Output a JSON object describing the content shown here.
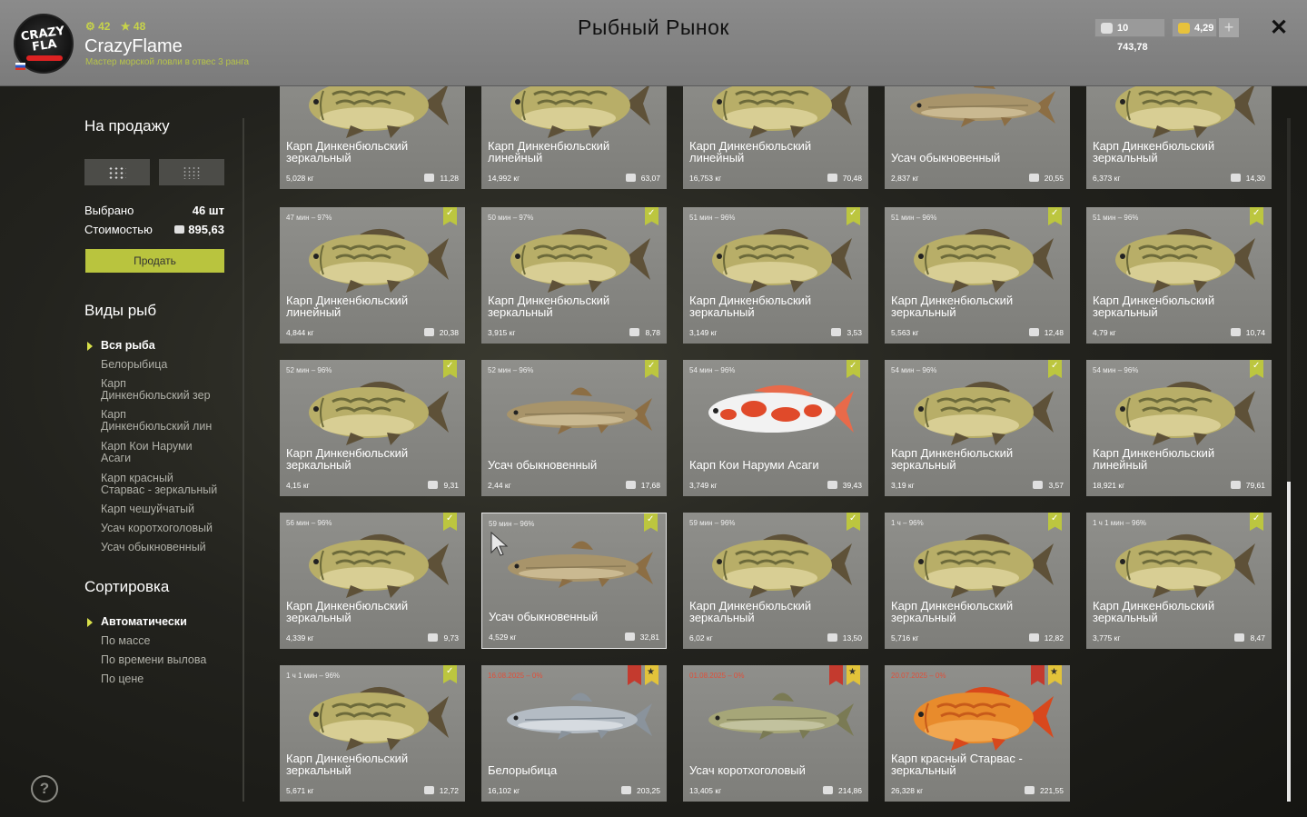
{
  "header": {
    "title": "Рыбный Рынок",
    "player": {
      "name": "CrazyFlame",
      "level": "42",
      "rank_level": "48",
      "rank": "Мастер морской ловли в отвес 3 ранга",
      "avatar_text": "CRAZY FLA"
    },
    "silver": "10 743,78",
    "gold": "4,29",
    "add_label": "+",
    "close_label": "✕"
  },
  "sidebar": {
    "sale_title": "На продажу",
    "selected_label": "Выбрано",
    "selected_value": "46 шт",
    "cost_label": "Стоимостью",
    "cost_value": "895,63",
    "sell_label": "Продать",
    "species_title": "Виды рыб",
    "species": [
      "Вся рыба",
      "Белорыбица",
      "Карп\nДинкенбюльский зер",
      "Карп\nДинкенбюльский лин",
      "Карп Кои Наруми\nАсаги",
      "Карп красный\nСтарвас - зеркальный",
      "Карп чешуйчатый",
      "Усач коротхоголовый",
      "Усач обыкновенный"
    ],
    "sort_title": "Сортировка",
    "sort_options": [
      "Автоматически",
      "По массе",
      "По времени вылова",
      "По цене"
    ],
    "help": "?"
  },
  "fish_types": {
    "carp": {
      "body": "#b8ae68",
      "scale": "#6c6a3a",
      "fin": "#5e5138",
      "belly": "#e6dca6"
    },
    "barbel": {
      "body": "#a8946a",
      "scale": "#8a7a56",
      "fin": "#8c6e44",
      "belly": "#d8c9a2"
    },
    "koi": {
      "body": "#f2f2f2",
      "scale": "#e04a2a",
      "fin": "#e86a4a",
      "belly": "#ffffff"
    },
    "whitefish": {
      "body": "#b4bcc4",
      "scale": "#7e8892",
      "fin": "#8a939c",
      "belly": "#e4e8ec"
    },
    "barbel_short": {
      "body": "#a6a678",
      "scale": "#7e7e58",
      "fin": "#7a7a54",
      "belly": "#cfcfae"
    },
    "red_carp": {
      "body": "#e88b2c",
      "scale": "#c75a1a",
      "fin": "#d8481c",
      "belly": "#f5b460"
    }
  },
  "cards": [
    {
      "meta": "",
      "name": "Карп Динкенбюльский\nзеркальный",
      "weight": "5,028 кг",
      "price": "11,28",
      "fish": "carp",
      "badge": "none"
    },
    {
      "meta": "",
      "name": "Карп Динкенбюльский\nлинейный",
      "weight": "14,992 кг",
      "price": "63,07",
      "fish": "carp",
      "badge": "none"
    },
    {
      "meta": "",
      "name": "Карп Динкенбюльский\nлинейный",
      "weight": "16,753 кг",
      "price": "70,48",
      "fish": "carp",
      "badge": "none"
    },
    {
      "meta": "",
      "name": "Усач обыкновенный",
      "weight": "2,837 кг",
      "price": "20,55",
      "fish": "barbel",
      "badge": "none"
    },
    {
      "meta": "",
      "name": "Карп Динкенбюльский\nзеркальный",
      "weight": "6,373 кг",
      "price": "14,30",
      "fish": "carp",
      "badge": "none"
    },
    {
      "meta": "47 мин – 97%",
      "name": "Карп Динкенбюльский\nлинейный",
      "weight": "4,844 кг",
      "price": "20,38",
      "fish": "carp",
      "badge": "check"
    },
    {
      "meta": "50 мин – 97%",
      "name": "Карп Динкенбюльский\nзеркальный",
      "weight": "3,915 кг",
      "price": "8,78",
      "fish": "carp",
      "badge": "check"
    },
    {
      "meta": "51 мин – 96%",
      "name": "Карп Динкенбюльский\nзеркальный",
      "weight": "3,149 кг",
      "price": "3,53",
      "fish": "carp",
      "badge": "check"
    },
    {
      "meta": "51 мин – 96%",
      "name": "Карп Динкенбюльский\nзеркальный",
      "weight": "5,563 кг",
      "price": "12,48",
      "fish": "carp",
      "badge": "check"
    },
    {
      "meta": "51 мин – 96%",
      "name": "Карп Динкенбюльский\nзеркальный",
      "weight": "4,79 кг",
      "price": "10,74",
      "fish": "carp",
      "badge": "check"
    },
    {
      "meta": "52 мин – 96%",
      "name": "Карп Динкенбюльский\nзеркальный",
      "weight": "4,15 кг",
      "price": "9,31",
      "fish": "carp",
      "badge": "check"
    },
    {
      "meta": "52 мин – 96%",
      "name": "Усач обыкновенный",
      "weight": "2,44 кг",
      "price": "17,68",
      "fish": "barbel",
      "badge": "check"
    },
    {
      "meta": "54 мин – 96%",
      "name": "Карп Кои Наруми Асаги",
      "weight": "3,749 кг",
      "price": "39,43",
      "fish": "koi",
      "badge": "check"
    },
    {
      "meta": "54 мин – 96%",
      "name": "Карп Динкенбюльский\nзеркальный",
      "weight": "3,19 кг",
      "price": "3,57",
      "fish": "carp",
      "badge": "check"
    },
    {
      "meta": "54 мин – 96%",
      "name": "Карп Динкенбюльский\nлинейный",
      "weight": "18,921 кг",
      "price": "79,61",
      "fish": "carp",
      "badge": "check"
    },
    {
      "meta": "56 мин – 96%",
      "name": "Карп Динкенбюльский\nзеркальный",
      "weight": "4,339 кг",
      "price": "9,73",
      "fish": "carp",
      "badge": "check"
    },
    {
      "meta": "59 мин – 96%",
      "name": "Усач обыкновенный",
      "weight": "4,529 кг",
      "price": "32,81",
      "fish": "barbel",
      "badge": "check",
      "selected": true
    },
    {
      "meta": "59 мин – 96%",
      "name": "Карп Динкенбюльский\nзеркальный",
      "weight": "6,02 кг",
      "price": "13,50",
      "fish": "carp",
      "badge": "check"
    },
    {
      "meta": "1 ч – 96%",
      "name": "Карп Динкенбюльский\nзеркальный",
      "weight": "5,716 кг",
      "price": "12,82",
      "fish": "carp",
      "badge": "check"
    },
    {
      "meta": "1 ч 1 мин – 96%",
      "name": "Карп Динкенбюльский\nзеркальный",
      "weight": "3,775 кг",
      "price": "8,47",
      "fish": "carp",
      "badge": "check"
    },
    {
      "meta": "1 ч 1 мин – 96%",
      "name": "Карп Динкенбюльский\nзеркальный",
      "weight": "5,671 кг",
      "price": "12,72",
      "fish": "carp",
      "badge": "check"
    },
    {
      "meta": "16.08.2025 – 0%",
      "name": "Белорыбица",
      "weight": "16,102 кг",
      "price": "203,25",
      "fish": "whitefish",
      "badge": "trophy",
      "red": true
    },
    {
      "meta": "01.08.2025 – 0%",
      "name": "Усач коротхоголовый",
      "weight": "13,405 кг",
      "price": "214,86",
      "fish": "barbel_short",
      "badge": "trophy",
      "red": true
    },
    {
      "meta": "20.07.2025 – 0%",
      "name": "Карп красный Старвас -\nзеркальный",
      "weight": "26,328 кг",
      "price": "221,55",
      "fish": "red_carp",
      "badge": "trophy",
      "red": true
    }
  ]
}
